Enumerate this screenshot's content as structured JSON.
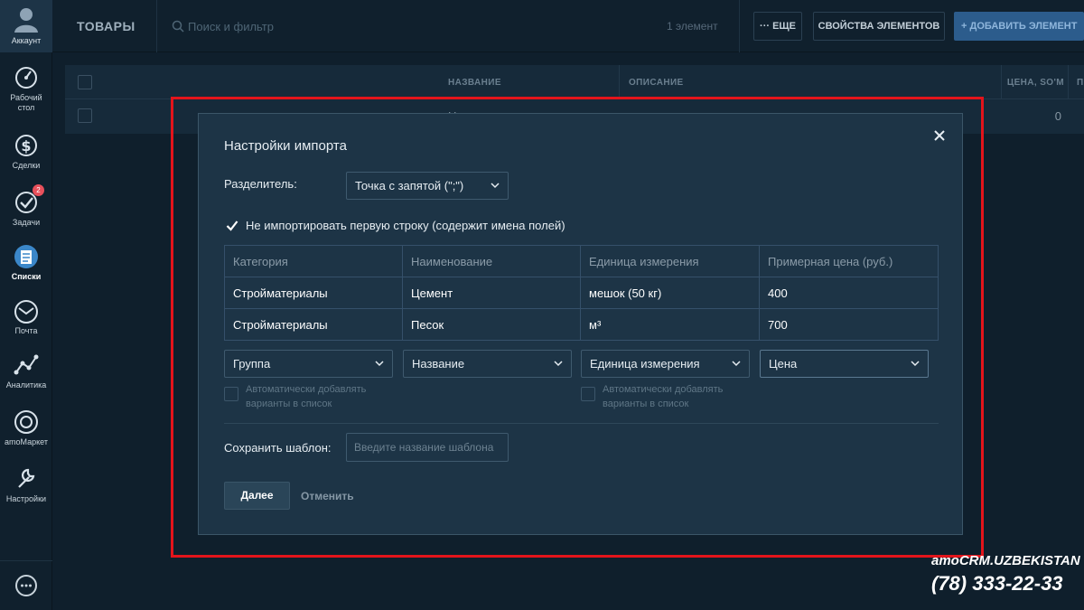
{
  "sidebar": {
    "account": "Аккаунт",
    "items": [
      {
        "label_1": "Рабочий",
        "label_2": "стол",
        "icon": "dashboard-icon"
      },
      {
        "label": "Сделки",
        "icon": "dollar-icon"
      },
      {
        "label": "Задачи",
        "icon": "tasks-icon",
        "badge": "2"
      },
      {
        "label": "Списки",
        "icon": "lists-icon",
        "active": true
      },
      {
        "label": "Почта",
        "icon": "mail-icon"
      },
      {
        "label": "Аналитика",
        "icon": "analytics-icon"
      },
      {
        "label": "amoМаркет",
        "icon": "market-icon"
      },
      {
        "label": "Настройки",
        "icon": "settings-icon"
      }
    ],
    "chat_icon": "chat-icon"
  },
  "topbar": {
    "title": "ТОВАРЫ",
    "search_placeholder": "Поиск и фильтр",
    "count": "1 элемент",
    "more_label": "··· ЕЩЕ",
    "props_label": "СВОЙСТВА ЭЛЕМЕНТОВ",
    "add_label": "+ ДОБАВИТЬ ЭЛЕМЕНТ"
  },
  "table": {
    "columns": [
      "НАЗВАНИЕ",
      "ОПИСАНИЕ",
      "ЦЕНА, SO'M",
      "П"
    ],
    "rows": [
      {
        "name": "Н",
        "price": "0"
      }
    ]
  },
  "modal": {
    "title": "Настройки импорта",
    "separator_label": "Разделитель:",
    "separator_value": "Точка с запятой (\";\")",
    "skip_first_row_label": "Не импортировать первую строку (содержит имена полей)",
    "skip_first_row_checked": true,
    "preview": {
      "headers": [
        "Категория",
        "Наименование",
        "Единица измерения",
        "Примерная цена (руб.)"
      ],
      "rows": [
        [
          "Стройматериалы",
          "Цемент",
          "мешок (50 кг)",
          "400"
        ],
        [
          "Стройматериалы",
          "Песок",
          "м³",
          "700"
        ]
      ]
    },
    "mapping": [
      "Группа",
      "Название",
      "Единица измерения",
      "Цена"
    ],
    "auto_add_1": "Автоматически добавлять",
    "auto_add_2": "варианты в список",
    "save_template_label": "Сохранить шаблон:",
    "template_placeholder": "Введите название шаблона",
    "next_label": "Далее",
    "cancel_label": "Отменить"
  },
  "watermark": {
    "brand": "amoCRM.UZBEKISTAN",
    "phone": "(78) 333-22-33"
  },
  "colors": {
    "background": "#0f1f2c",
    "modal": "#1d3446",
    "accent": "#2c5c8c",
    "highlight": "#e3141b",
    "badge": "#e8505b"
  }
}
